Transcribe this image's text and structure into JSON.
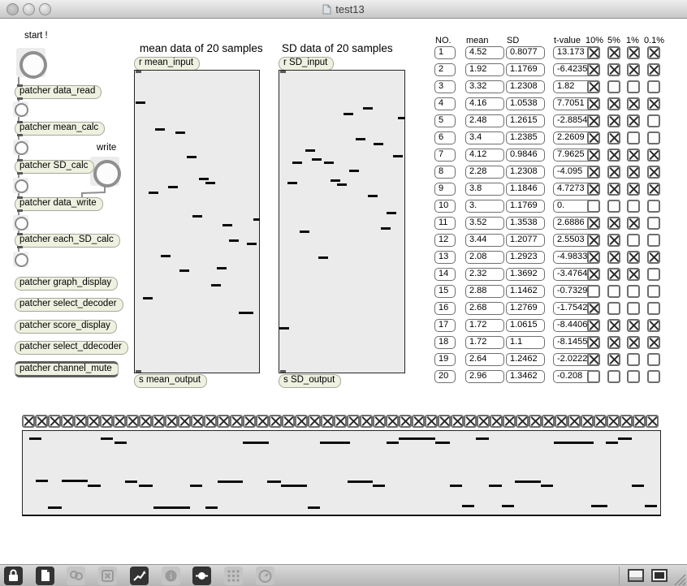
{
  "window": {
    "title": "test13"
  },
  "left_panel": {
    "start_label": "start !",
    "write_label": "write",
    "patchers": [
      "patcher data_read",
      "patcher mean_calc",
      "patcher SD_calc",
      "patcher data_write",
      "patcher each_SD_calc",
      "patcher graph_display",
      "patcher select_decoder",
      "patcher score_display",
      "patcher select_ddecoder",
      "patcher channel_mute"
    ]
  },
  "mean_panel": {
    "title": "mean data of 20 samples",
    "receive": "r mean_input",
    "send": "s mean_output",
    "marks": [
      [
        1,
        38,
        12
      ],
      [
        25,
        71,
        12
      ],
      [
        50,
        75,
        12
      ],
      [
        64,
        105,
        12
      ],
      [
        79,
        132,
        12
      ],
      [
        87,
        137,
        12
      ],
      [
        41,
        142,
        12
      ],
      [
        17,
        149,
        12
      ],
      [
        71,
        178,
        12
      ],
      [
        146,
        182,
        8
      ],
      [
        108,
        189,
        12
      ],
      [
        116,
        208,
        12
      ],
      [
        138,
        212,
        12
      ],
      [
        32,
        227,
        12
      ],
      [
        55,
        245,
        12
      ],
      [
        101,
        242,
        12
      ],
      [
        94,
        263,
        12
      ],
      [
        10,
        279,
        12
      ],
      [
        128,
        297,
        18
      ]
    ]
  },
  "sd_panel": {
    "title": "SD data of 20 samples",
    "receive": "r SD_input",
    "send": "s SD_output",
    "marks": [
      [
        103,
        45,
        12
      ],
      [
        79,
        52,
        12
      ],
      [
        146,
        57,
        9
      ],
      [
        94,
        83,
        12
      ],
      [
        116,
        89,
        12
      ],
      [
        32,
        97,
        12
      ],
      [
        140,
        104,
        12
      ],
      [
        40,
        108,
        12
      ],
      [
        16,
        112,
        12
      ],
      [
        55,
        112,
        12
      ],
      [
        86,
        122,
        12
      ],
      [
        63,
        134,
        12
      ],
      [
        10,
        137,
        12
      ],
      [
        71,
        139,
        12
      ],
      [
        109,
        153,
        12
      ],
      [
        132,
        174,
        12
      ],
      [
        125,
        193,
        12
      ],
      [
        25,
        197,
        12
      ],
      [
        48,
        229,
        12
      ],
      [
        0,
        316,
        12
      ]
    ]
  },
  "table": {
    "headers": [
      "NO.",
      "mean",
      "SD",
      "t-value",
      "10%",
      "5%",
      "1%",
      "0.1%"
    ],
    "rows": [
      {
        "no": "1",
        "mean": "4.52",
        "sd": "0.8077",
        "t": "13.173",
        "checks": [
          true,
          true,
          true,
          true
        ]
      },
      {
        "no": "2",
        "mean": "1.92",
        "sd": "1.1769",
        "t": "-6.4235",
        "checks": [
          true,
          true,
          true,
          true
        ]
      },
      {
        "no": "3",
        "mean": "3.32",
        "sd": "1.2308",
        "t": "1.82",
        "checks": [
          true,
          false,
          false,
          false
        ]
      },
      {
        "no": "4",
        "mean": "4.16",
        "sd": "1.0538",
        "t": "7.7051",
        "checks": [
          true,
          true,
          true,
          true
        ]
      },
      {
        "no": "5",
        "mean": "2.48",
        "sd": "1.2615",
        "t": "-2.8854",
        "checks": [
          true,
          true,
          true,
          false
        ]
      },
      {
        "no": "6",
        "mean": "3.4",
        "sd": "1.2385",
        "t": "2.2609",
        "checks": [
          true,
          true,
          false,
          false
        ]
      },
      {
        "no": "7",
        "mean": "4.12",
        "sd": "0.9846",
        "t": "7.9625",
        "checks": [
          true,
          true,
          true,
          true
        ]
      },
      {
        "no": "8",
        "mean": "2.28",
        "sd": "1.2308",
        "t": "-4.095",
        "checks": [
          true,
          true,
          true,
          true
        ]
      },
      {
        "no": "9",
        "mean": "3.8",
        "sd": "1.1846",
        "t": "4.7273",
        "checks": [
          true,
          true,
          true,
          true
        ]
      },
      {
        "no": "10",
        "mean": "3.",
        "sd": "1.1769",
        "t": "0.",
        "checks": [
          false,
          false,
          false,
          false
        ]
      },
      {
        "no": "11",
        "mean": "3.52",
        "sd": "1.3538",
        "t": "2.6886",
        "checks": [
          true,
          true,
          true,
          false
        ]
      },
      {
        "no": "12",
        "mean": "3.44",
        "sd": "1.2077",
        "t": "2.5503",
        "checks": [
          true,
          true,
          false,
          false
        ]
      },
      {
        "no": "13",
        "mean": "2.08",
        "sd": "1.2923",
        "t": "-4.9833",
        "checks": [
          true,
          true,
          true,
          true
        ]
      },
      {
        "no": "14",
        "mean": "2.32",
        "sd": "1.3692",
        "t": "-3.4764",
        "checks": [
          true,
          true,
          true,
          false
        ]
      },
      {
        "no": "15",
        "mean": "2.88",
        "sd": "1.1462",
        "t": "-0.7329",
        "checks": [
          false,
          false,
          false,
          false
        ]
      },
      {
        "no": "16",
        "mean": "2.68",
        "sd": "1.2769",
        "t": "-1.7542",
        "checks": [
          true,
          false,
          false,
          false
        ]
      },
      {
        "no": "17",
        "mean": "1.72",
        "sd": "1.0615",
        "t": "-8.4406",
        "checks": [
          true,
          true,
          true,
          true
        ]
      },
      {
        "no": "18",
        "mean": "1.72",
        "sd": "1.1",
        "t": "-8.1455",
        "checks": [
          true,
          true,
          true,
          true
        ]
      },
      {
        "no": "19",
        "mean": "2.64",
        "sd": "1.2462",
        "t": "-2.0222",
        "checks": [
          true,
          true,
          false,
          false
        ]
      },
      {
        "no": "20",
        "mean": "2.96",
        "sd": "1.3462",
        "t": "-0.208",
        "checks": [
          false,
          false,
          false,
          false
        ]
      }
    ]
  },
  "bottom": {
    "toggle_count": 49,
    "all_checked": true,
    "marks": [
      [
        8,
        8,
        15
      ],
      [
        96,
        8,
        15
      ],
      [
        113,
        13,
        15
      ],
      [
        271,
        13,
        32
      ],
      [
        366,
        13,
        32
      ],
      [
        16,
        60,
        15
      ],
      [
        48,
        60,
        32
      ],
      [
        80,
        66,
        16
      ],
      [
        126,
        61,
        15
      ],
      [
        143,
        66,
        17
      ],
      [
        206,
        66,
        15
      ],
      [
        240,
        61,
        31
      ],
      [
        301,
        61,
        17
      ],
      [
        318,
        66,
        32
      ],
      [
        31,
        93,
        17
      ],
      [
        161,
        93,
        45
      ],
      [
        225,
        93,
        15
      ],
      [
        351,
        93,
        15
      ],
      [
        393,
        13,
        10
      ],
      [
        448,
        13,
        15
      ],
      [
        463,
        8,
        45
      ],
      [
        508,
        13,
        18
      ],
      [
        558,
        8,
        16
      ],
      [
        654,
        13,
        49
      ],
      [
        718,
        13,
        15
      ],
      [
        733,
        8,
        17
      ],
      [
        400,
        61,
        31
      ],
      [
        431,
        66,
        15
      ],
      [
        526,
        66,
        15
      ],
      [
        574,
        66,
        16
      ],
      [
        606,
        61,
        32
      ],
      [
        638,
        66,
        15
      ],
      [
        750,
        66,
        15
      ],
      [
        541,
        91,
        15
      ],
      [
        590,
        91,
        15
      ],
      [
        700,
        91,
        20
      ],
      [
        766,
        91,
        15
      ]
    ]
  },
  "toolbar": {
    "icons": [
      {
        "name": "lock-icon",
        "active": true
      },
      {
        "name": "new-object-icon",
        "active": true
      },
      {
        "name": "magnify-icon",
        "active": false
      },
      {
        "name": "delete-icon",
        "active": false
      },
      {
        "name": "presentation-chart-icon",
        "active": true
      },
      {
        "name": "info-icon",
        "active": false
      },
      {
        "name": "connection-icon",
        "active": true
      },
      {
        "name": "grid-icon",
        "active": false
      },
      {
        "name": "timer-icon",
        "active": false
      }
    ],
    "window_buttons": [
      {
        "name": "tile-window-icon"
      },
      {
        "name": "front-window-icon"
      }
    ]
  }
}
